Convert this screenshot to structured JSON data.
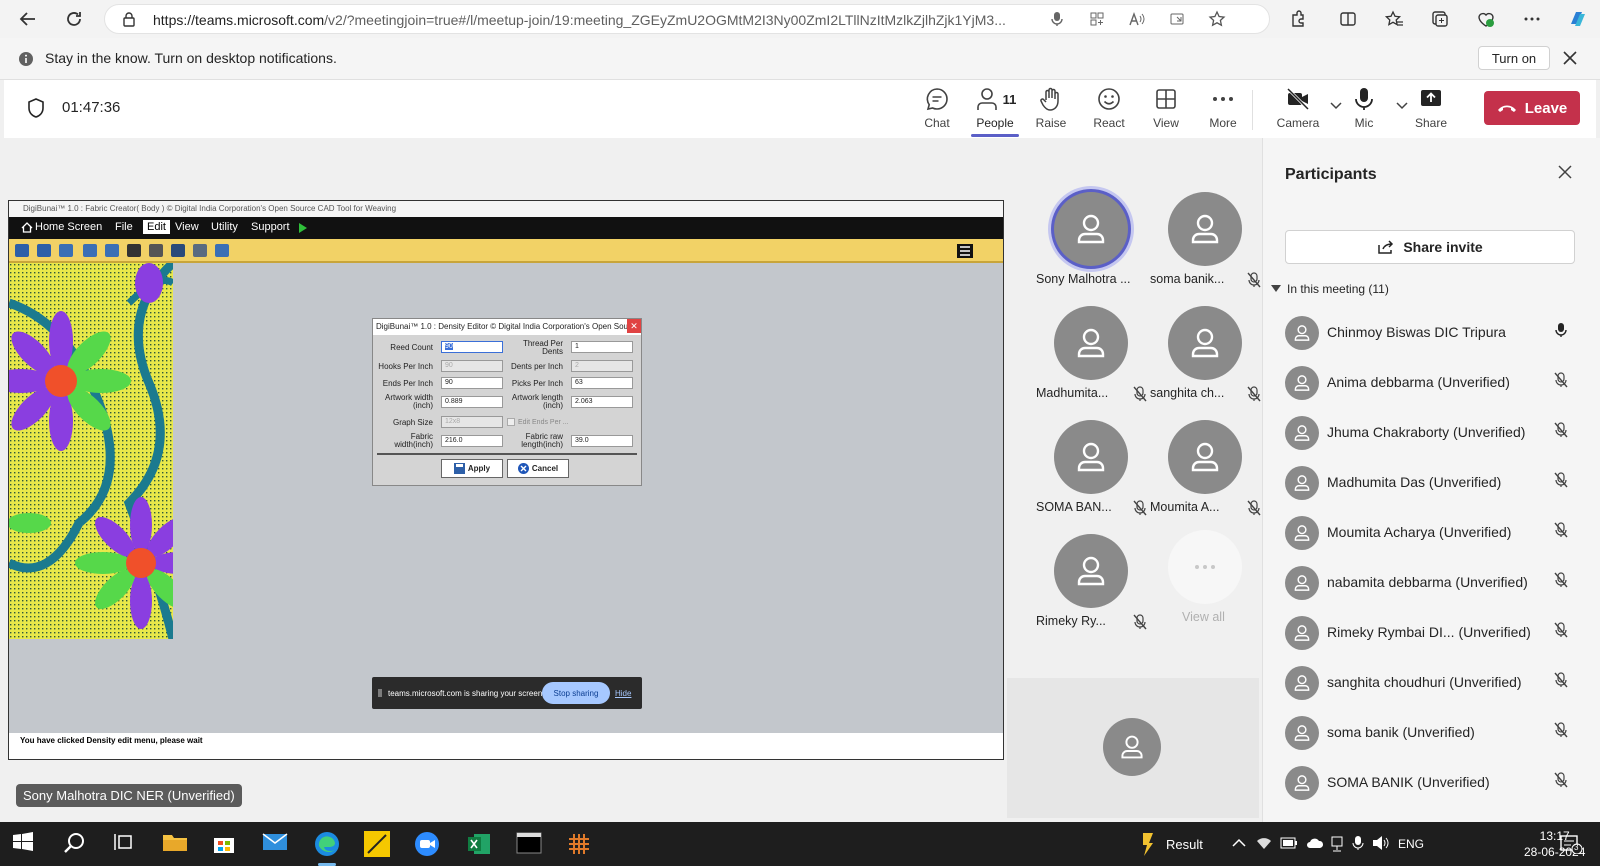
{
  "browser": {
    "url_host": "https://teams.microsoft.com",
    "url_path": "/v2/?meetingjoin=true#/l/meetup-join/19:meeting_ZGEyZmU2OGMtM2I3Ny00ZmI2LTllNzItMzlkZjlhZjk1YjM3..."
  },
  "notification": {
    "text": "Stay in the know. Turn on desktop notifications.",
    "turn_on_label": "Turn on"
  },
  "toolbar": {
    "timer": "01:47:36",
    "chat_label": "Chat",
    "people_label": "People",
    "people_count": "11",
    "raise_label": "Raise",
    "react_label": "React",
    "view_label": "View",
    "more_label": "More",
    "camera_label": "Camera",
    "mic_label": "Mic",
    "share_label": "Share",
    "leave_label": "Leave",
    "leave_color": "#c4314b",
    "accent_color": "#5b5fc7"
  },
  "shared_app": {
    "title": "DigiBunai™ 1.0 : Fabric Creator( Body ) © Digital India Corporation's Open Source CAD Tool for Weaving",
    "menu": [
      "Home Screen",
      "File",
      "Edit",
      "View",
      "Utility",
      "Support"
    ],
    "status": "You have clicked Density edit menu, please wait",
    "dialog": {
      "title": "DigiBunai™ 1.0 : Density Editor © Digital India Corporation's Open Sour...",
      "reed_count_label": "Reed Count",
      "reed_count_value": "90",
      "thread_per_dents_label": "Thread Per Dents",
      "thread_per_dents_value": "1",
      "hooks_per_inch_label": "Hooks Per Inch",
      "hooks_per_inch_value": "90",
      "dents_per_inch_label": "Dents per Inch",
      "dents_per_inch_value": "2",
      "ends_per_inch_label": "Ends Per Inch",
      "ends_per_inch_value": "90",
      "picks_per_inch_label": "Picks Per Inch",
      "picks_per_inch_value": "63",
      "artwork_width_label": "Artwork width (inch)",
      "artwork_width_value": "0.889",
      "artwork_length_label": "Artwork length (inch)",
      "artwork_length_value": "2.063",
      "graph_size_label": "Graph Size",
      "graph_size_value": "12x8",
      "edit_ends_label": "Edit Ends Per ...",
      "fabric_width_label": "Fabric width(inch)",
      "fabric_width_value": "216.0",
      "fabric_raw_length_label": "Fabric raw length(inch)",
      "fabric_raw_length_value": "39.0",
      "apply_label": "Apply",
      "cancel_label": "Cancel"
    },
    "sharing_banner": {
      "text": "teams.microsoft.com is sharing your screen.",
      "stop_label": "Stop sharing",
      "hide_label": "Hide"
    }
  },
  "presenter_tag": "Sony Malhotra DIC NER (Unverified)",
  "video_tiles": [
    {
      "name": "Sony Malhotra ...",
      "speaking": true,
      "muted": false
    },
    {
      "name": "soma banik...",
      "speaking": false,
      "muted": true
    },
    {
      "name": "Madhumita...",
      "speaking": false,
      "muted": true
    },
    {
      "name": "sanghita ch...",
      "speaking": false,
      "muted": true
    },
    {
      "name": "SOMA BAN...",
      "speaking": false,
      "muted": true
    },
    {
      "name": "Moumita A...",
      "speaking": false,
      "muted": true
    },
    {
      "name": "Rimeky Ry...",
      "speaking": false,
      "muted": true
    }
  ],
  "view_all_label": "View all",
  "participants": {
    "title": "Participants",
    "share_invite_label": "Share invite",
    "section_label": "In this meeting (11)",
    "list": [
      {
        "name": "Chinmoy Biswas DIC Tripura",
        "mic": "on"
      },
      {
        "name": "Anima debbarma (Unverified)",
        "mic": "off"
      },
      {
        "name": "Jhuma Chakraborty (Unverified)",
        "mic": "off"
      },
      {
        "name": "Madhumita Das (Unverified)",
        "mic": "off"
      },
      {
        "name": "Moumita Acharya (Unverified)",
        "mic": "off"
      },
      {
        "name": "nabamita debbarma (Unverified)",
        "mic": "off"
      },
      {
        "name": "Rimeky Rymbai DI...  (Unverified)",
        "mic": "off"
      },
      {
        "name": "sanghita choudhuri (Unverified)",
        "mic": "off"
      },
      {
        "name": "soma banik (Unverified)",
        "mic": "off"
      },
      {
        "name": "SOMA BANIK (Unverified)",
        "mic": "off"
      }
    ]
  },
  "taskbar": {
    "weather_label": "Result",
    "language": "ENG",
    "time": "13:17",
    "date": "28-06-2024",
    "notification_count": "3"
  }
}
